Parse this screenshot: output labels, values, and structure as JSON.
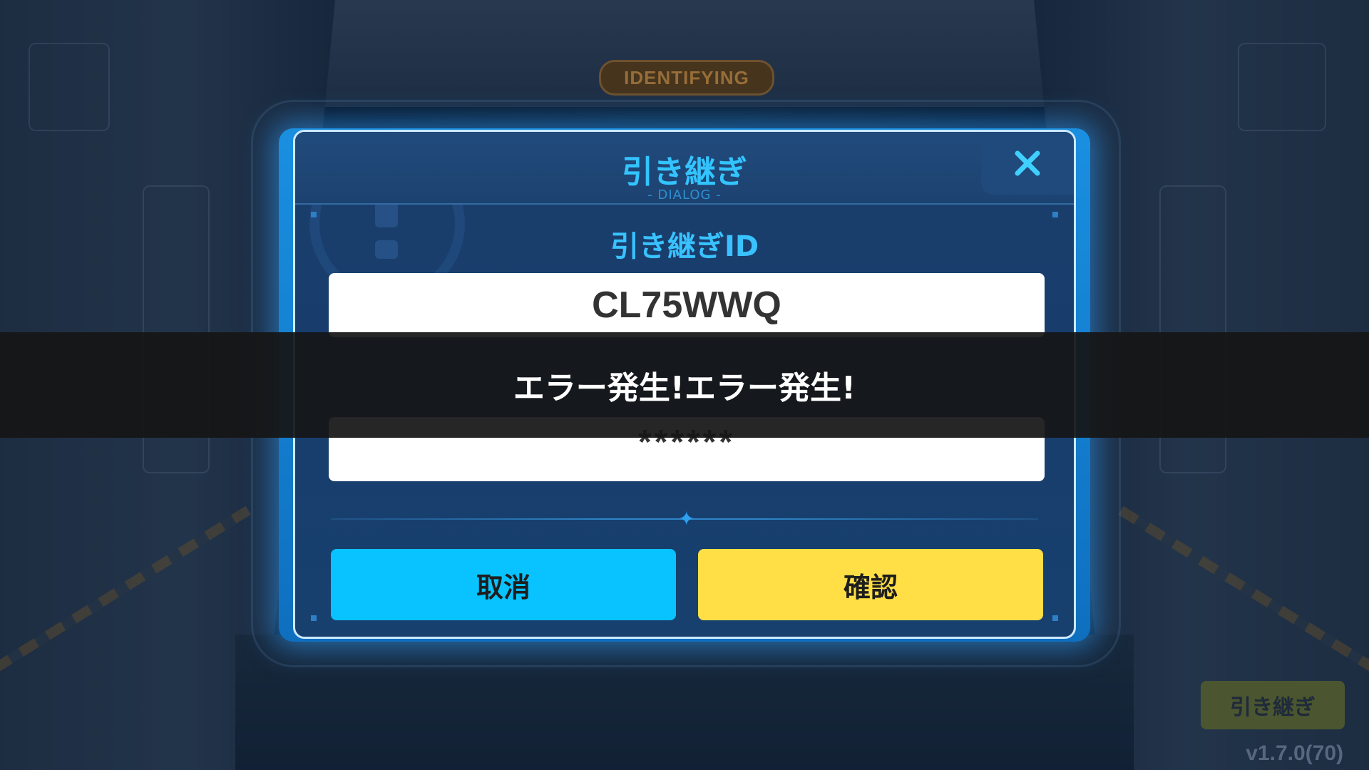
{
  "background": {
    "sign_text": "IDENTIFYING"
  },
  "dialog": {
    "title": "引き継ぎ",
    "subtitle": "- DIALOG -",
    "close_icon": "close-icon",
    "id_label": "引き継ぎID",
    "id_value": "CL75WWQ",
    "password_value": "******",
    "cancel_label": "取消",
    "confirm_label": "確認"
  },
  "toast": {
    "message": "エラー発生!エラー発生!"
  },
  "corner": {
    "handover_label": "引き継ぎ",
    "version": "v1.7.0(70)"
  },
  "colors": {
    "accent": "#33c4ff",
    "cancel_button": "#08c3ff",
    "confirm_button": "#ffdf45",
    "toast_bg": "#161616"
  }
}
